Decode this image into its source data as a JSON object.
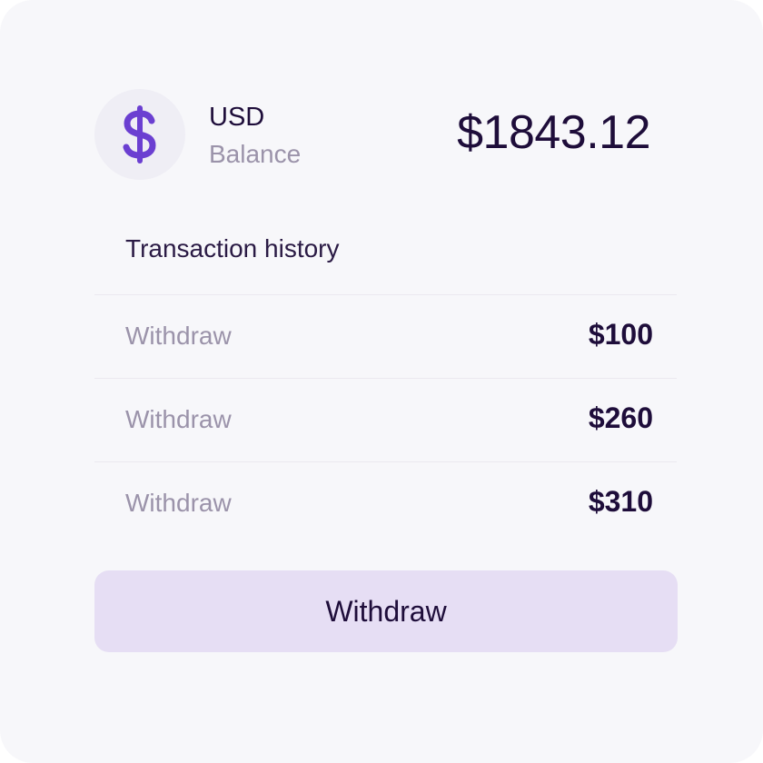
{
  "account": {
    "currency_icon": "dollar-icon",
    "currency_code": "USD",
    "balance_label": "Balance",
    "balance_amount": "$1843.12"
  },
  "history": {
    "title": "Transaction history",
    "transactions": [
      {
        "type": "Withdraw",
        "amount": "$100"
      },
      {
        "type": "Withdraw",
        "amount": "$260"
      },
      {
        "type": "Withdraw",
        "amount": "$310"
      }
    ]
  },
  "actions": {
    "withdraw_label": "Withdraw"
  },
  "colors": {
    "accent": "#6b3fd1",
    "button_bg": "#e6def4",
    "text_dark": "#1e0d3a",
    "text_muted": "#9b93aa",
    "card_bg": "#f7f7fa"
  }
}
